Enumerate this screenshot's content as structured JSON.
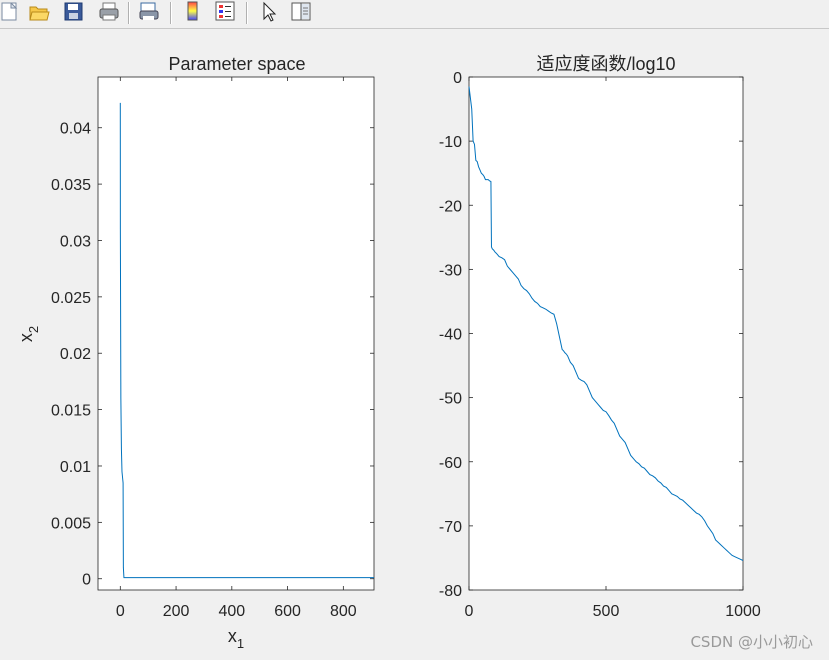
{
  "toolbar": {
    "icons": [
      "new-figure-icon",
      "open-folder-icon",
      "save-icon",
      "print-icon",
      "print-preview-icon",
      "colorbar-icon",
      "legend-icon",
      "pointer-arrow-icon",
      "property-editor-icon"
    ]
  },
  "watermark": "CSDN @小小初心",
  "colors": {
    "line": "#0072bd",
    "axes": "#262626",
    "background": "#f0f0f0",
    "plot_bg": "#ffffff"
  },
  "chart_data": [
    {
      "type": "line",
      "title": "Parameter space",
      "xlabel": "x",
      "xlabel_sub": "1",
      "ylabel": "x",
      "ylabel_sub": "2",
      "xlim": [
        -80,
        910
      ],
      "ylim": [
        -0.001,
        0.0445
      ],
      "xticks": [
        0,
        200,
        400,
        600,
        800
      ],
      "xtick_labels": [
        "0",
        "200",
        "400",
        "600",
        "800"
      ],
      "yticks": [
        0,
        0.005,
        0.01,
        0.015,
        0.02,
        0.025,
        0.03,
        0.035,
        0.04
      ],
      "ytick_labels": [
        "0",
        "0.005",
        "0.01",
        "0.015",
        "0.02",
        "0.025",
        "0.03",
        "0.035",
        "0.04"
      ],
      "grid": false,
      "series": [
        {
          "x": [
            0,
            0.2,
            1,
            2,
            4,
            5,
            6,
            8,
            10,
            11,
            13,
            910
          ],
          "y": [
            0.0422,
            0.031,
            0.0245,
            0.016,
            0.0115,
            0.0105,
            0.0095,
            0.009,
            0.0085,
            0.001,
            0.0001,
            0.0001
          ]
        }
      ]
    },
    {
      "type": "line",
      "title": "适应度函数/log10",
      "xlabel": "",
      "ylabel": "",
      "xlim": [
        0,
        1000
      ],
      "ylim": [
        -80,
        0
      ],
      "xticks": [
        0,
        500,
        1000
      ],
      "xtick_labels": [
        "0",
        "500",
        "1000"
      ],
      "yticks": [
        0,
        -10,
        -20,
        -30,
        -40,
        -50,
        -60,
        -70,
        -80
      ],
      "ytick_labels": [
        "0",
        "-10",
        "-20",
        "-30",
        "-40",
        "-50",
        "-60",
        "-70",
        "-80"
      ],
      "grid": false,
      "series": [
        {
          "x": [
            0,
            10,
            15,
            20,
            25,
            30,
            35,
            40,
            45,
            50,
            55,
            60,
            65,
            70,
            75,
            80,
            82,
            85,
            90,
            95,
            100,
            110,
            120,
            130,
            140,
            150,
            160,
            170,
            180,
            190,
            200,
            210,
            220,
            230,
            240,
            250,
            260,
            270,
            280,
            290,
            300,
            310,
            320,
            330,
            340,
            345,
            350,
            355,
            360,
            365,
            370,
            380,
            390,
            400,
            410,
            420,
            430,
            440,
            450,
            460,
            470,
            480,
            490,
            500,
            510,
            520,
            530,
            540,
            550,
            560,
            570,
            580,
            590,
            600,
            610,
            620,
            630,
            640,
            650,
            660,
            670,
            680,
            690,
            700,
            710,
            720,
            730,
            740,
            750,
            760,
            770,
            780,
            785,
            790,
            800,
            810,
            820,
            830,
            840,
            850,
            860,
            870,
            880,
            890,
            900,
            910,
            920,
            930,
            940,
            950,
            960,
            970,
            980,
            990,
            1000
          ],
          "y": [
            -1.5,
            -5,
            -10,
            -10.5,
            -13,
            -13.2,
            -14,
            -14.5,
            -15,
            -15.2,
            -15.5,
            -16,
            -16,
            -16,
            -16.2,
            -16.3,
            -26.5,
            -26.8,
            -27,
            -27.3,
            -27.5,
            -28,
            -28.2,
            -28.5,
            -29.5,
            -30,
            -30.5,
            -31,
            -31.5,
            -32.5,
            -33,
            -33.3,
            -33.8,
            -34.5,
            -35,
            -35.3,
            -35.8,
            -36,
            -36.2,
            -36.5,
            -36.8,
            -37,
            -38.5,
            -40.5,
            -42.5,
            -42.7,
            -43,
            -43.2,
            -43.5,
            -44,
            -44.5,
            -45,
            -46,
            -47,
            -47.3,
            -47.5,
            -48,
            -49,
            -50,
            -50.5,
            -51,
            -51.5,
            -52,
            -52.2,
            -52.8,
            -53.5,
            -54,
            -55,
            -56,
            -56.5,
            -57,
            -58,
            -59,
            -59.5,
            -60,
            -60.3,
            -60.8,
            -61,
            -61.5,
            -62,
            -62.2,
            -62.5,
            -63,
            -63.3,
            -63.8,
            -64,
            -64.5,
            -65,
            -65.2,
            -65.4,
            -65.8,
            -66,
            -66.2,
            -66.4,
            -66.8,
            -67.2,
            -67.6,
            -68,
            -68.2,
            -68.6,
            -69.2,
            -70,
            -70.6,
            -71.2,
            -72.2,
            -72.6,
            -73,
            -73.4,
            -73.8,
            -74.2,
            -74.6,
            -74.8,
            -75,
            -75.2,
            -75.4
          ]
        }
      ]
    }
  ]
}
